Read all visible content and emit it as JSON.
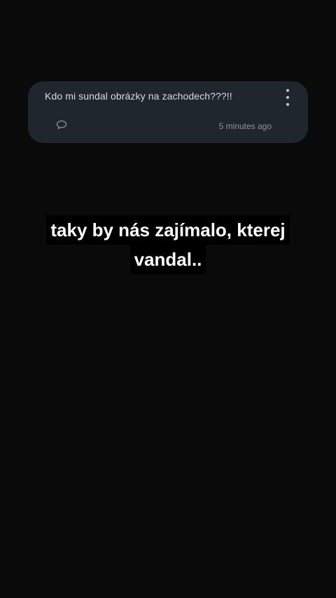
{
  "comment": {
    "text": "Kdo mi sundal obrázky na zachodech???!!",
    "timestamp": "5 minutes ago",
    "reply_icon": "speech-bubble-icon",
    "more_icon": "more-vertical-icon"
  },
  "caption": {
    "line1": "taky by nás zajímalo, kterej",
    "line2": "vandal.."
  },
  "colors": {
    "background": "#0a0a0a",
    "card": "#1f262e",
    "card_text": "#d7dde3",
    "muted": "#8d959c",
    "caption_text": "#ffffff",
    "caption_bg": "#000000"
  }
}
